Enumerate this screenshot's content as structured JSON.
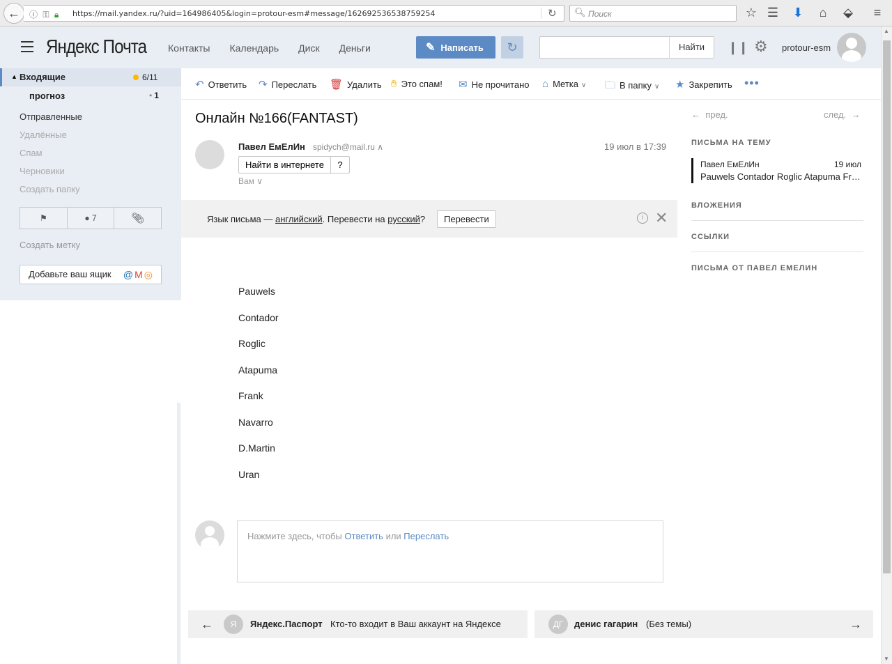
{
  "browser": {
    "url": "https://mail.yandex.ru/?uid=164986405&login=protour-esm#message/162692536538759254",
    "search_placeholder": "Поиск"
  },
  "header": {
    "logo": "Яндекс Почта",
    "nav": [
      "Контакты",
      "Календарь",
      "Диск",
      "Деньги"
    ],
    "compose_label": "Написать",
    "search_button": "Найти",
    "search_value": "",
    "username": "protour-esm"
  },
  "sidebar": {
    "inbox_label": "Входящие",
    "inbox_count": "6/11",
    "subfolder_label": "прогноз",
    "subfolder_count": "1",
    "folders": [
      "Отправленные",
      "Удалённые",
      "Спам",
      "Черновики",
      "Создать папку"
    ],
    "filter_unread_count": "7",
    "create_label": "Создать метку",
    "add_mailbox": "Добавьте ваш ящик"
  },
  "toolbar": {
    "reply": "Ответить",
    "forward": "Переслать",
    "delete": "Удалить",
    "spam": "Это спам!",
    "unread": "Не прочитано",
    "label": "Метка",
    "folder": "В папку",
    "pin": "Закрепить"
  },
  "message": {
    "subject": "Онлайн №166(FANTAST)",
    "sender_name": "Павел ЕмЕлИн",
    "sender_email": "spidych@mail.ru",
    "date": "19 июл в 17:39",
    "find_button": "Найти в интернете",
    "help_button": "?",
    "to": "Вам",
    "translate": {
      "prefix": "Язык письма — ",
      "lang": "английский",
      "middle": ". Перевести на ",
      "target": "русский",
      "suffix": "?",
      "button": "Перевести"
    },
    "body": [
      "Pauwels",
      "Contador",
      "Roglic",
      "Atapuma",
      "Frank",
      "Navarro",
      "D.Martin",
      "Uran"
    ]
  },
  "reply": {
    "prefix": "Нажмите здесь, чтобы ",
    "reply_link": "Ответить",
    "or": " или ",
    "forward_link": "Переслать"
  },
  "prev_mail": {
    "avatar_letter": "Я",
    "sender": "Яндекс.Паспорт",
    "subject": "Кто-то входит в Ваш аккаунт на Яндексе"
  },
  "next_mail": {
    "avatar_letters": "ДГ",
    "sender": "денис гагарин",
    "subject": "(Без темы)"
  },
  "right_panel": {
    "prev": "пред.",
    "next": "след.",
    "thread_title": "ПИСЬМА НА ТЕМУ",
    "thread_sender": "Павел ЕмЕлИн",
    "thread_date": "19 июл",
    "thread_subject": "Pauwels Contador Roglic Atapuma Frank Navarro D.Martin Uran",
    "attachments": "ВЛОЖЕНИЯ",
    "links": "ССЫЛКИ",
    "from_sender": "ПИСЬМА ОТ ПАВЕЛ ЕМЕЛИН"
  }
}
